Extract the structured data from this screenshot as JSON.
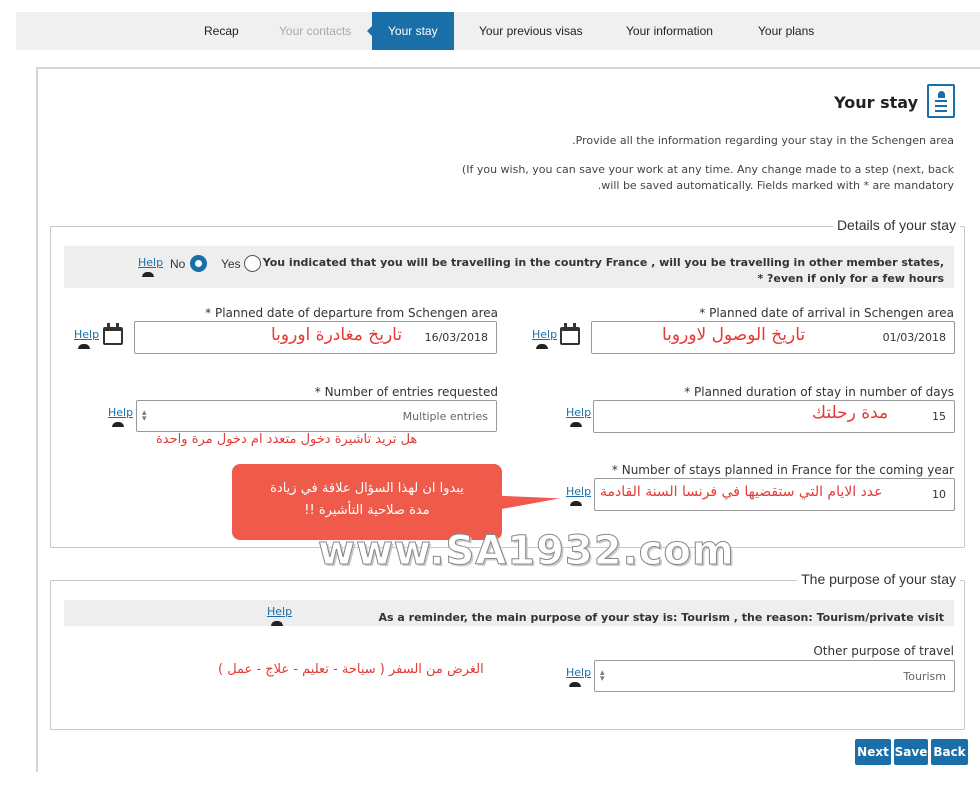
{
  "nav": {
    "tabs": [
      {
        "label": "Recap",
        "state": "normal"
      },
      {
        "label": "Your contacts",
        "state": "disabled"
      },
      {
        "label": "Your stay",
        "state": "active"
      },
      {
        "label": "Your previous visas",
        "state": "normal"
      },
      {
        "label": "Your information",
        "state": "normal"
      },
      {
        "label": "Your plans",
        "state": "normal"
      }
    ]
  },
  "header": {
    "title": "Your stay",
    "icon": "id-card-icon",
    "intro_line1": ".Provide all the information regarding your stay in the Schengen area",
    "intro_line2": "(If you wish, you can save your work at any time. Any change made to a step (next, back",
    "intro_line3": ".will be saved automatically. Fields marked with * are mandatory"
  },
  "details": {
    "legend": "Details of your stay",
    "other_states_question": {
      "line1": "You indicated that you will be travelling in the country France , will you be travelling in other member states,",
      "line2": "* ?even if only for a few hours",
      "help": "Help",
      "options": [
        {
          "label": "No",
          "selected": true
        },
        {
          "label": "Yes",
          "selected": false
        }
      ]
    },
    "departure": {
      "label": "* Planned date of departure from Schengen area",
      "value": "16/03/2018",
      "annotation": "تاريخ مغادرة اوروبا",
      "help": "Help"
    },
    "arrival": {
      "label": "* Planned date of arrival in Schengen area",
      "value": "01/03/2018",
      "annotation": "تاريخ الوصول لاوروبا",
      "help": "Help"
    },
    "entries": {
      "label": "* Number of entries requested",
      "value": "Multiple entries",
      "annotation": "هل تريد تاشيرة دخول متعدد ام دخول مرة واحدة",
      "help": "Help"
    },
    "duration": {
      "label": "* Planned duration of stay in number of days",
      "value": "15",
      "annotation": "مدة رحلتك",
      "help": "Help"
    },
    "stays_france": {
      "label": "* Number of stays planned in France for the coming year",
      "value": "10",
      "annotation": "عدد الايام التي ستقضيها في فرنسا السنة القادمة",
      "help": "Help"
    },
    "callout": {
      "line1": "يبدوا ان لهذا السؤال علاقة في زيادة",
      "line2": "مدة صلاحية التأشيرة !!"
    }
  },
  "watermark": "www.SA1932.com",
  "purpose": {
    "legend": "The purpose of your stay",
    "reminder": "As a reminder, the main purpose of your stay is: Tourism , the reason: Tourism/private visit",
    "help": "Help",
    "other": {
      "label": "Other purpose of travel",
      "value": "Tourism",
      "annotation": "الغرض من السفر ( سياحة - تعليم - علاج - عمل )",
      "help": "Help"
    }
  },
  "actions": {
    "next": "Next",
    "save": "Save",
    "back": "Back"
  },
  "colors": {
    "accent": "#1a6fa8",
    "annotation_red": "#e53935",
    "callout_red": "#f05a4a"
  }
}
